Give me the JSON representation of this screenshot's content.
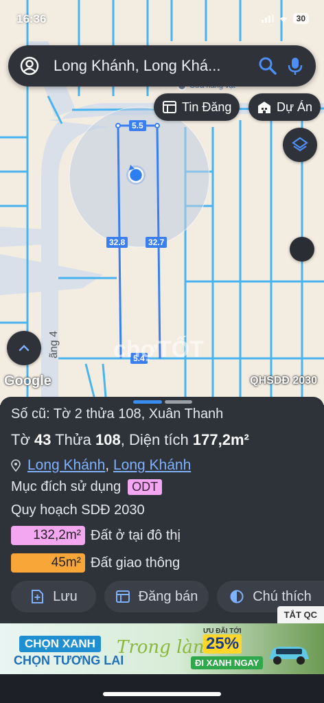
{
  "status_bar": {
    "time": "16:36",
    "battery": "30"
  },
  "search": {
    "text": "Long Khánh, Long Khá..."
  },
  "map": {
    "chips": {
      "listing": "Tin Đăng",
      "project": "Dự Án"
    },
    "dimensions": {
      "top": "5.5",
      "left": "32.8",
      "right": "32.7",
      "bottom": "5.4"
    },
    "poi_label": "Cửa hàng vật",
    "road_label": "ãng 4",
    "google_logo": "Google",
    "watermark": "chợTỐT",
    "plan_label": "QHSDĐ 2030",
    "colors": {
      "parcel_line": "#47b4f0",
      "highlight": "#3a7ef0",
      "background": "#f3ece1"
    }
  },
  "sheet": {
    "old_number": "Số cũ: Tờ 2 thửa 108, Xuân Thanh",
    "sheet_label": "Tờ",
    "sheet_no": "43",
    "parcel_label": "Thửa",
    "parcel_no": "108",
    "area_label": "Diện tích",
    "area_value": "177,2m²",
    "address_ward": "Long Khánh",
    "address_sep": ",",
    "address_city": "Long Khánh",
    "purpose_label": "Mục đích sử dụng",
    "purpose_code": "ODT",
    "plan": "Quy hoạch SDĐ 2030",
    "zones": [
      {
        "area": "132,2m²",
        "label": "Đất ở tại đô thị",
        "color": "#f3a7f0"
      },
      {
        "area": "45m²",
        "label": "Đất giao thông",
        "color": "#f7a637"
      }
    ],
    "actions": {
      "save": "Lưu",
      "post_sale": "Đăng bán",
      "legend": "Chú thích"
    }
  },
  "ad": {
    "close": "TẮT QC",
    "headline": "CHỌN XANH",
    "subline": "CHỌN TƯƠNG LAI",
    "script": "Trong lành",
    "promo_top": "ƯU ĐÃI TỚI",
    "promo_value": "25%",
    "cta": "ĐI XANH NGAY"
  }
}
